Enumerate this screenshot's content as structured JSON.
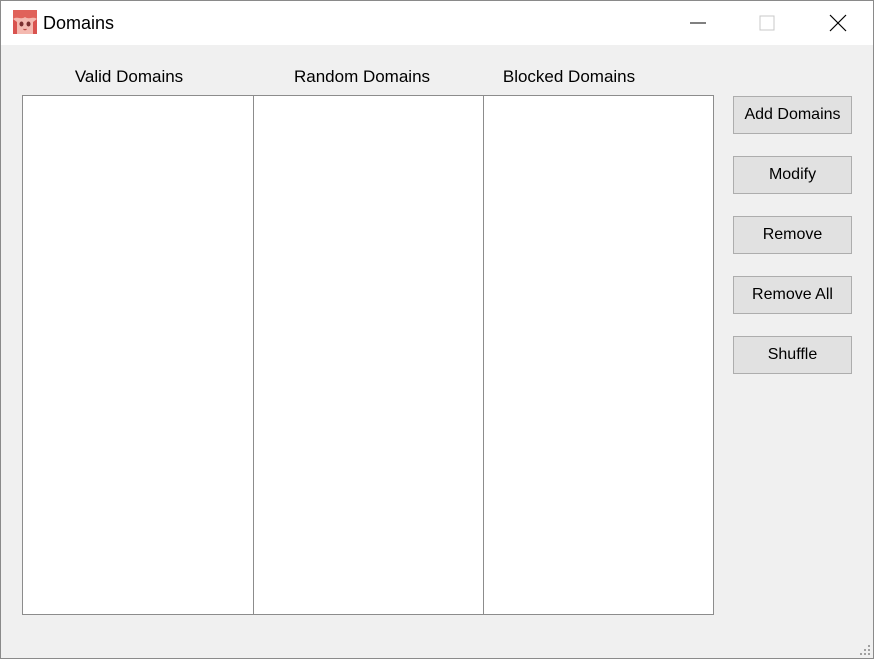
{
  "window": {
    "title": "Domains",
    "app_icon": "anime-avatar-icon",
    "controls": {
      "minimize_icon": "minimize-icon",
      "maximize_icon": "maximize-icon",
      "close_icon": "close-icon"
    }
  },
  "lists": {
    "headers": [
      "Valid Domains",
      "Random Domains",
      "Blocked Domains"
    ],
    "valid_items": [],
    "random_items": [],
    "blocked_items": []
  },
  "actions": {
    "add_label": "Add Domains",
    "modify_label": "Modify",
    "remove_label": "Remove",
    "remove_all_label": "Remove All",
    "shuffle_label": "Shuffle"
  },
  "colors": {
    "window_bg": "#f0f0f0",
    "titlebar_bg": "#ffffff",
    "button_bg": "#e1e1e1",
    "button_border": "#adadad",
    "list_border": "#8c8c8c"
  }
}
